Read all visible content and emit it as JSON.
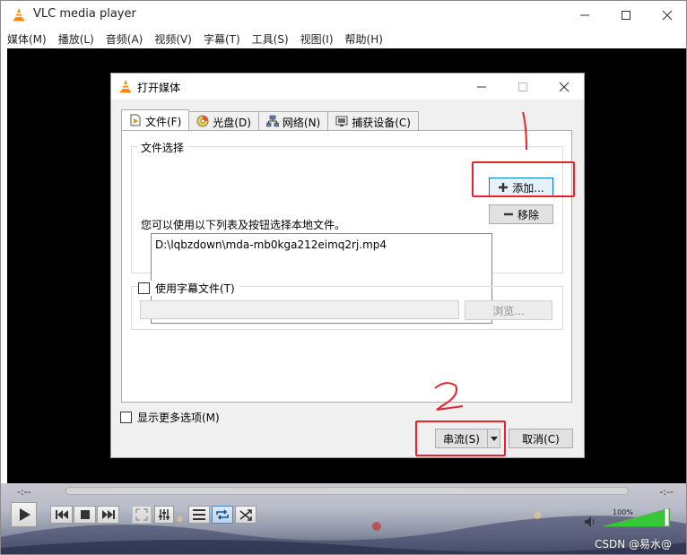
{
  "window": {
    "title": "VLC media player",
    "controls": {
      "minimize": "—",
      "maximize": "☐",
      "close": "✕"
    }
  },
  "menubar": {
    "items": [
      "媒体(M)",
      "播放(L)",
      "音频(A)",
      "视频(V)",
      "字幕(T)",
      "工具(S)",
      "视图(I)",
      "帮助(H)"
    ]
  },
  "player": {
    "elapsed": "-:--",
    "remaining": "-:--",
    "volume": "100%",
    "volume_level": 1.0
  },
  "watermark": "CSDN @易水@",
  "dialog": {
    "title": "打开媒体",
    "tabs": [
      {
        "label": "文件(F)",
        "icon": "file-icon",
        "active": true
      },
      {
        "label": "光盘(D)",
        "icon": "disc-icon",
        "active": false
      },
      {
        "label": "网络(N)",
        "icon": "network-icon",
        "active": false
      },
      {
        "label": "捕获设备(C)",
        "icon": "capture-icon",
        "active": false
      }
    ],
    "file_group": {
      "title": "文件选择",
      "hint": "您可以使用以下列表及按钮选择本地文件。",
      "files": [
        "D:\\lqbzdown\\mda-mb0kga212eimq2rj.mp4"
      ],
      "add_label": "添加...",
      "remove_label": "移除"
    },
    "subtitle_group": {
      "checkbox_label": "使用字幕文件(T)",
      "browse_label": "浏览..."
    },
    "more_options_label": "显示更多选项(M)",
    "stream_label": "串流(S)",
    "cancel_label": "取消(C)"
  },
  "annotations": {
    "mark_1": "1",
    "mark_2": "2",
    "color": "#e8222a"
  }
}
